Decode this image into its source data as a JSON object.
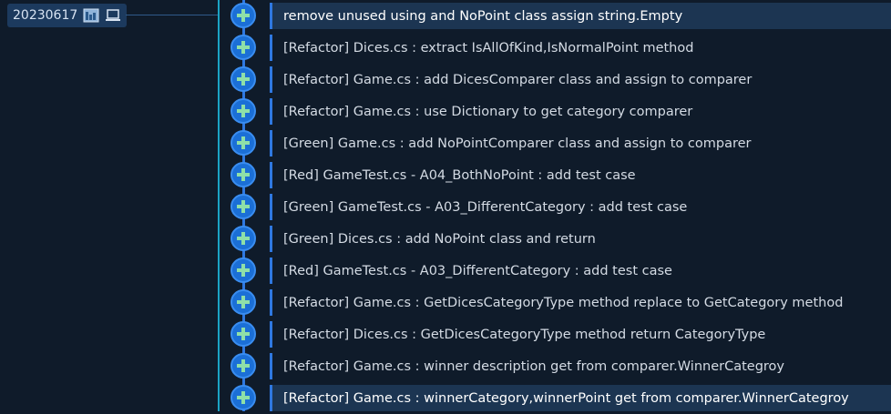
{
  "branch": {
    "label": "20230617",
    "icons": [
      "image-icon",
      "laptop-icon"
    ]
  },
  "colors": {
    "background": "#0f1b2a",
    "accent": "#2f78e0",
    "divider": "#1ba3c4",
    "selected_row": "#1c3552"
  },
  "commits": [
    {
      "message": "remove unused using and NoPoint class assign string.Empty"
    },
    {
      "message": "[Refactor] Dices.cs : extract IsAllOfKind,IsNormalPoint method"
    },
    {
      "message": "[Refactor] Game.cs : add DicesComparer class and assign to comparer"
    },
    {
      "message": "[Refactor] Game.cs : use Dictionary to get category comparer"
    },
    {
      "message": "[Green] Game.cs :  add NoPointComparer class and assign to comparer"
    },
    {
      "message": "[Red] GameTest.cs - A04_BothNoPoint : add test case"
    },
    {
      "message": "[Green] GameTest.cs - A03_DifferentCategory : add test case"
    },
    {
      "message": "[Green] Dices.cs : add NoPoint class and return"
    },
    {
      "message": "[Red] GameTest.cs - A03_DifferentCategory : add test case"
    },
    {
      "message": "[Refactor] Game.cs : GetDicesCategoryType method replace to GetCategory method"
    },
    {
      "message": "[Refactor] Dices.cs : GetDicesCategoryType method return CategoryType"
    },
    {
      "message": "[Refactor] Game.cs : winner description get from comparer.WinnerCategroy"
    },
    {
      "message": "[Refactor] Game.cs : winnerCategory,winnerPoint get from comparer.WinnerCategroy"
    }
  ]
}
